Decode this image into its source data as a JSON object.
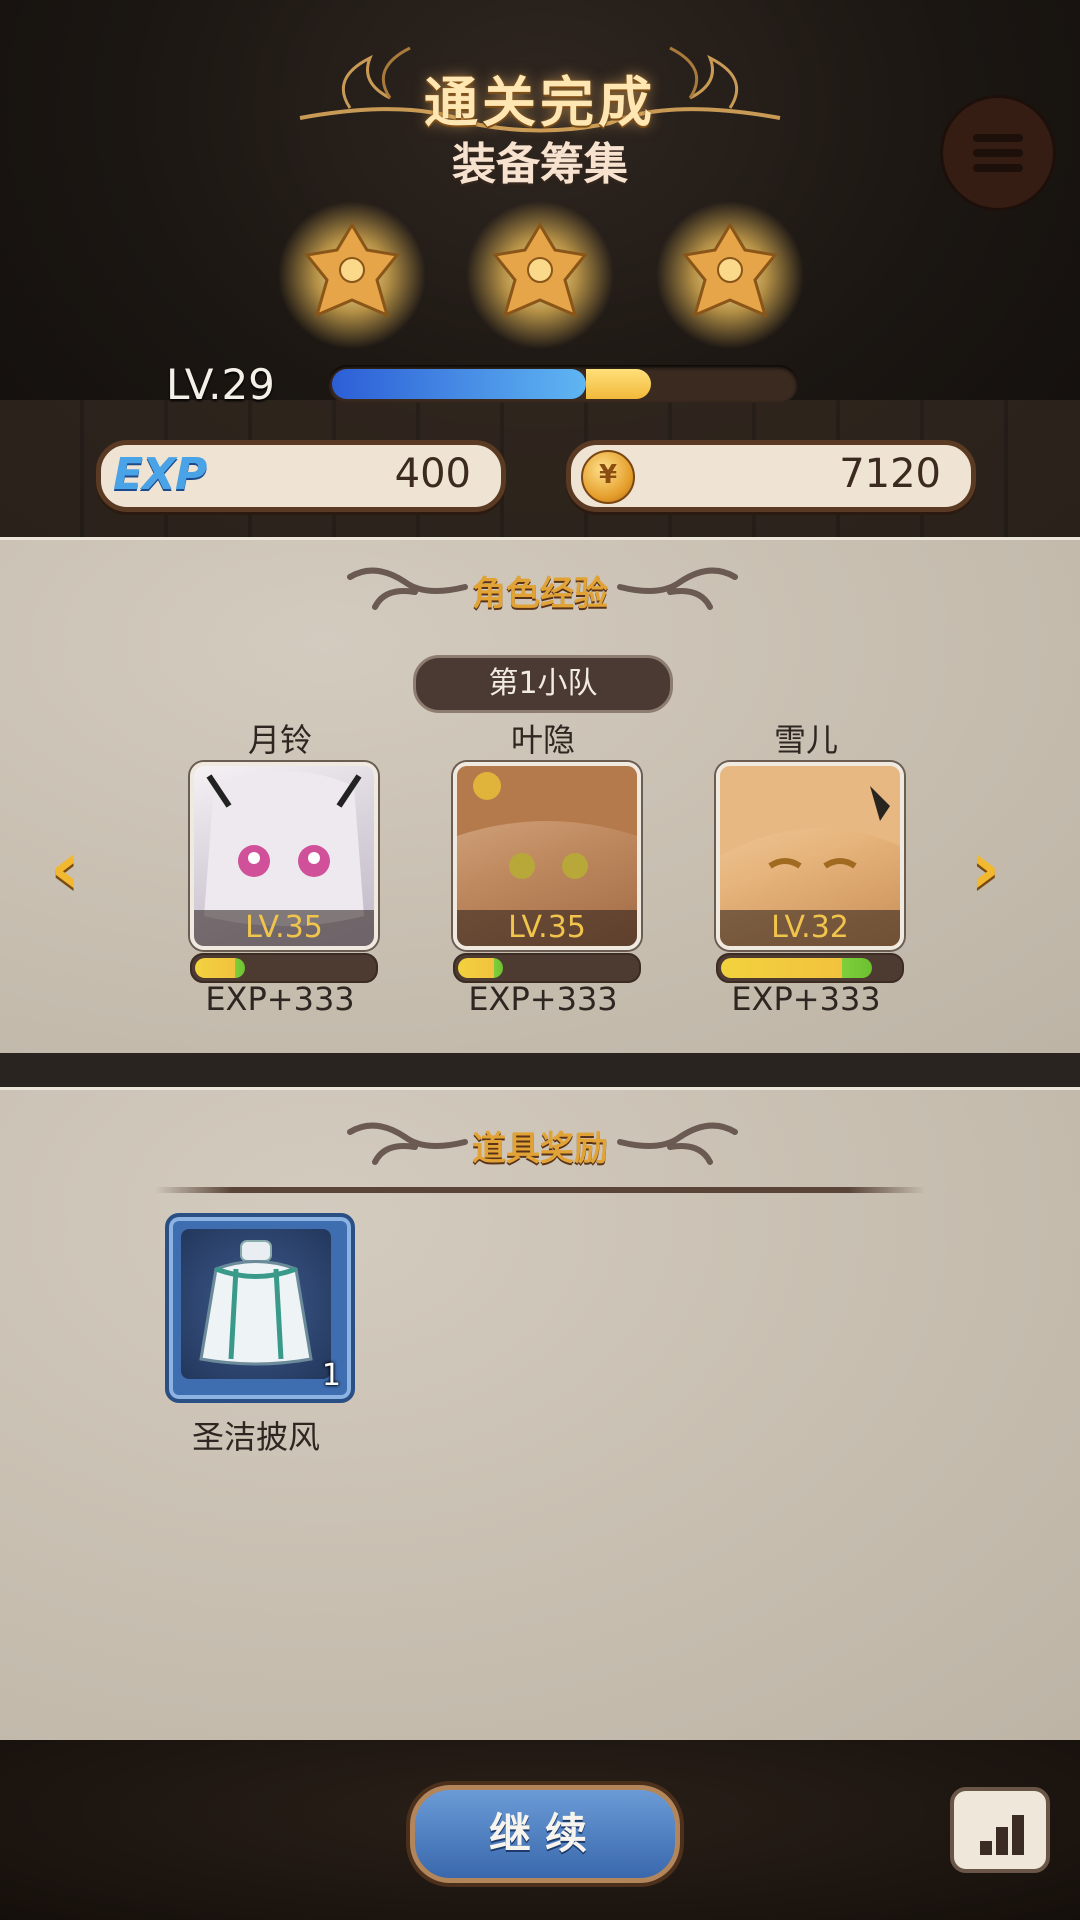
{
  "header": {
    "title": "通关完成",
    "subtitle": "装备筹集",
    "stars": 3,
    "player_level": "LV.29",
    "level_progress": 0.55,
    "level_gain": 0.14
  },
  "rewards": {
    "exp_label": "EXP",
    "exp_value": "400",
    "gold_value": "7120",
    "gold_icon_glyph": "¥"
  },
  "character_section": {
    "title": "角色经验",
    "team_label": "第1小队",
    "characters": [
      {
        "name": "月铃",
        "level": "LV.35",
        "gain": "EXP+333",
        "progress": 0.28
      },
      {
        "name": "叶隐",
        "level": "LV.35",
        "gain": "EXP+333",
        "progress": 0.25
      },
      {
        "name": "雪儿",
        "level": "LV.32",
        "gain": "EXP+333",
        "progress": 0.85
      }
    ],
    "prev_arrow": "‹",
    "next_arrow": "›"
  },
  "item_section": {
    "title": "道具奖励",
    "items": [
      {
        "name": "圣洁披风",
        "count": "1",
        "icon": "cape-icon"
      }
    ]
  },
  "footer": {
    "continue_label": "继续",
    "stats_icon": "bar-chart-icon"
  },
  "colors": {
    "accent_gold": "#e2a336",
    "button_blue": "#3a68ad",
    "level_text": "#f1c44c"
  }
}
